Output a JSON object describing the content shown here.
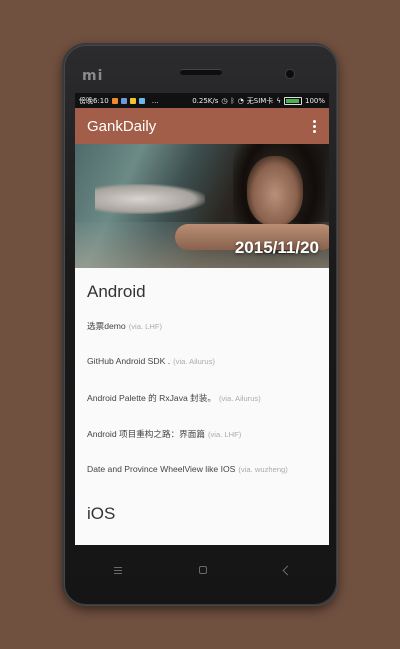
{
  "device": {
    "logo": "mi"
  },
  "statusbar": {
    "left_text": "傍晚6:10",
    "speed": "0.25K/s",
    "carrier": "无SIM卡",
    "battery": "100%",
    "notification_colors": [
      "#f08a2c",
      "#6e9bd8",
      "#f2c32c",
      "#6ab8f2"
    ]
  },
  "appbar": {
    "title": "GankDaily",
    "menu_icon": "more-vert-icon"
  },
  "hero": {
    "date": "2015/11/20"
  },
  "sections": [
    {
      "title": "Android",
      "items": [
        {
          "text": "选票demo",
          "via": "(via. LHF)"
        },
        {
          "text": "GitHub Android SDK .",
          "via": "(via. Ailurus)"
        },
        {
          "text": "Android Palette 的 RxJava 封装。",
          "via": "(via. Ailurus)"
        },
        {
          "text": "Android 项目重构之路：界面篇",
          "via": "(via. LHF)"
        },
        {
          "text": "Date and Province WheelView like IOS",
          "via": "(via. wuzheng)"
        }
      ]
    },
    {
      "title": "iOS",
      "items": []
    }
  ],
  "navbar": {
    "menu_icon": "menu-icon",
    "home_icon": "home-icon",
    "back_icon": "back-icon"
  },
  "colors": {
    "background": "#70503f",
    "appbar": "#a25e48",
    "screen": "#fafafa"
  }
}
